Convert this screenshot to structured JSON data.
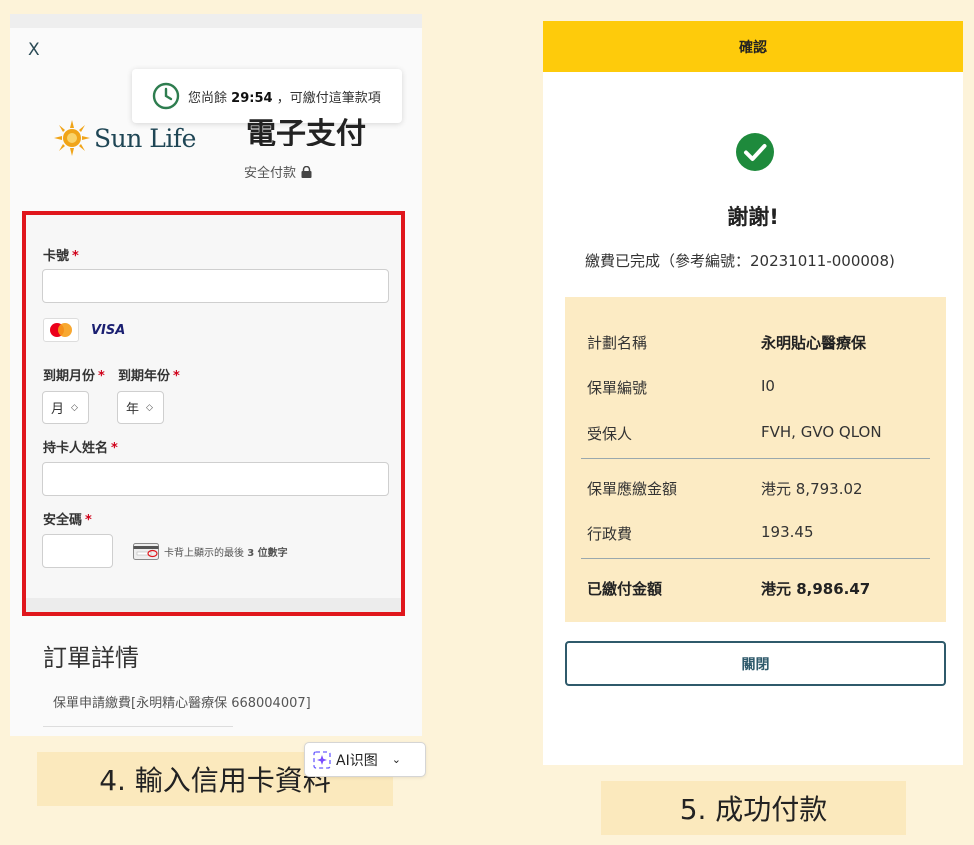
{
  "left": {
    "close": "X",
    "timer": {
      "prefix": "您尚餘",
      "time": "29:54",
      "suffix": "，可繳付這筆款項"
    },
    "brand": "Sun Life",
    "title": "電子支付",
    "secure": "安全付款",
    "form": {
      "card_number_label": "卡號",
      "required_mark": "*",
      "card_brands": [
        "mastercard",
        "VISA"
      ],
      "expiry_month_label": "到期月份",
      "expiry_year_label": "到期年份",
      "month_value": "月",
      "year_value": "年",
      "holder_label": "持卡人姓名",
      "cvv_label": "安全碼",
      "cvv_hint_pre": "卡背上顯示的最後",
      "cvv_hint_bold": "3 位數字"
    },
    "order": {
      "title": "訂單詳情",
      "item": "保單申請繳費[永明精心醫療保 668004007]"
    },
    "ai_badge": "AI识图"
  },
  "caption_4": "4. 輸入信用卡資料",
  "right": {
    "header": "確認",
    "thanks": "謝謝!",
    "ref_line": "繳費已完成（參考編號：20231011-000008)",
    "details": [
      {
        "key": "計劃名稱",
        "value": "永明貼心醫療保",
        "bold_value": true
      },
      {
        "key": "保單編號",
        "value": "I0"
      },
      {
        "key": "受保人",
        "value": "FVH, GVO QLON"
      },
      {
        "key": "保單應繳金額",
        "value": "港元 8,793.02"
      },
      {
        "key": "行政費",
        "value": "193.45"
      },
      {
        "key": "已繳付金額",
        "value": "港元 8,986.47",
        "bold": true
      }
    ],
    "close_button": "關閉"
  },
  "caption_5": "5. 成功付款",
  "colors": {
    "background": "#fdf3d9",
    "caption_bg": "#fbe9bd",
    "confirm_bar": "#fecb0b",
    "details_bg": "#fcebc4",
    "highlight_frame": "#e0161c",
    "check_green": "#1e8a3c",
    "brand_teal": "#1f4655"
  }
}
